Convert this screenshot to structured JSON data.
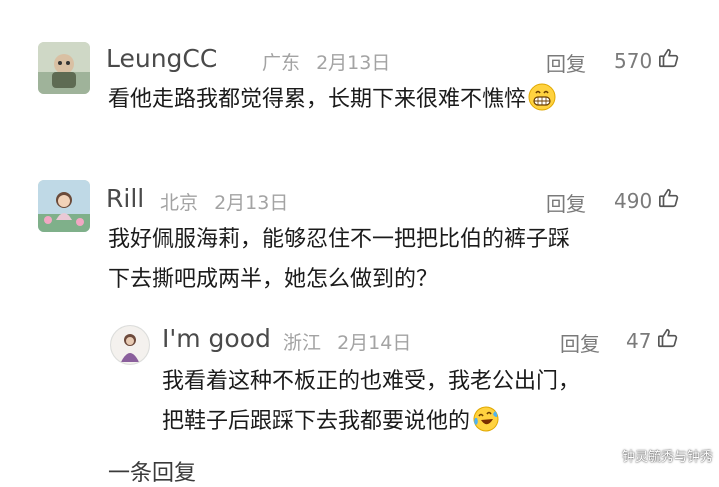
{
  "comments": [
    {
      "username": "LeungCC",
      "location": "广东",
      "date": "2月13日",
      "reply_label": "回复",
      "likes": "570",
      "text_lines": [
        "看他走路我都觉得累，长期下来很难不憔悴"
      ],
      "emoji": "grin-emoji"
    },
    {
      "username": "Rill",
      "location": "北京",
      "date": "2月13日",
      "reply_label": "回复",
      "likes": "490",
      "text_lines": [
        "我好佩服海莉，能够忍住不一把把比伯的裤子踩",
        "下去撕吧成两半，她怎么做到的？"
      ]
    }
  ],
  "reply": {
    "username": "I'm good",
    "location": "浙江",
    "date": "2月14日",
    "reply_label": "回复",
    "likes": "47",
    "text_lines": [
      "我看着这种不板正的也难受，我老公出门，",
      "把鞋子后跟踩下去我都要说他的"
    ],
    "emoji": "laugh-cry-emoji"
  },
  "partial_next": "一条回复",
  "watermark": "钟灵毓秀与钟秀"
}
